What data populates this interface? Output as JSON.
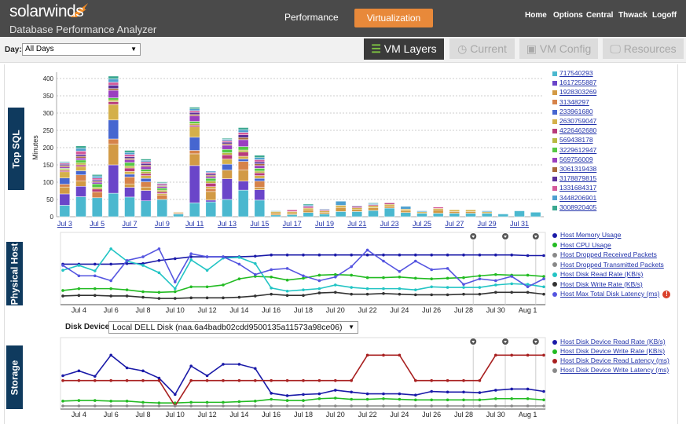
{
  "header": {
    "brand": "solarwinds",
    "product": "Database Performance Analyzer",
    "nav_main": [
      {
        "label": "Performance",
        "active": false
      },
      {
        "label": "Virtualization",
        "active": true
      }
    ],
    "nav_links": [
      "Home",
      "Options",
      "Central",
      "Thwack",
      "Logoff"
    ],
    "accent_color": "#e8893a"
  },
  "toolbar": {
    "day_label": "Day:",
    "day_value": "All Days",
    "tabs": [
      {
        "label": "VM Layers",
        "icon": "layers-icon",
        "active": true
      },
      {
        "label": "Current",
        "icon": "clock-icon",
        "active": false
      },
      {
        "label": "VM Config",
        "icon": "vm-icon",
        "active": false
      },
      {
        "label": "Resources",
        "icon": "monitor-icon",
        "active": false
      }
    ]
  },
  "sections": {
    "top_sql": "Top SQL",
    "physical_host": "Physical Host",
    "storage": "Storage"
  },
  "storage_controls": {
    "disk_label": "Disk Device:",
    "disk_value": "Local DELL Disk (naa.6a4badb02cdd9500135a11573a98ce06)"
  },
  "chart_data": [
    {
      "type": "bar",
      "stacked": true,
      "ylabel": "Minutes",
      "ylim": [
        0,
        400
      ],
      "yticks": [
        0,
        50,
        100,
        150,
        200,
        250,
        300,
        350,
        400
      ],
      "grid": true,
      "legend": "right",
      "categories": [
        "Jul 3",
        "Jul 4",
        "Jul 5",
        "Jul 6",
        "Jul 7",
        "Jul 8",
        "Jul 9",
        "Jul 10",
        "Jul 11",
        "Jul 12",
        "Jul 13",
        "Jul 14",
        "Jul 15",
        "Jul 16",
        "Jul 17",
        "Jul 18",
        "Jul 19",
        "Jul 20",
        "Jul 21",
        "Jul 22",
        "Jul 23",
        "Jul 24",
        "Jul 25",
        "Jul 26",
        "Jul 27",
        "Jul 28",
        "Jul 29",
        "Jul 30",
        "Jul 31",
        "Aug 1"
      ],
      "xtick_labels": [
        "Jul 3",
        "Jul 5",
        "Jul 7",
        "Jul 9",
        "Jul 11",
        "Jul 13",
        "Jul 15",
        "Jul 17",
        "Jul 19",
        "Jul 21",
        "Jul 23",
        "Jul 25",
        "Jul 27",
        "Jul 29",
        "Jul 31"
      ],
      "series": [
        {
          "name": "717540293",
          "color": "#4bb8cf",
          "values": [
            33,
            58,
            55,
            68,
            57,
            46,
            50,
            8,
            40,
            43,
            50,
            77,
            48,
            5,
            6,
            12,
            8,
            15,
            15,
            18,
            25,
            12,
            10,
            10,
            10,
            10,
            10,
            8,
            17,
            13
          ]
        },
        {
          "name": "1617255887",
          "color": "#6a45c9",
          "values": [
            33,
            30,
            0,
            82,
            28,
            30,
            0,
            0,
            108,
            5,
            60,
            26,
            30,
            0,
            0,
            0,
            0,
            0,
            0,
            0,
            0,
            0,
            0,
            0,
            0,
            0,
            0,
            0,
            0,
            0
          ]
        },
        {
          "name": "1928303269",
          "color": "#d29a45",
          "values": [
            20,
            15,
            0,
            60,
            10,
            10,
            0,
            0,
            34,
            25,
            25,
            32,
            7,
            6,
            5,
            8,
            5,
            12,
            6,
            8,
            6,
            6,
            0,
            10,
            5,
            5,
            0,
            0,
            0,
            0
          ]
        },
        {
          "name": "31348297",
          "color": "#d6834a",
          "values": [
            8,
            18,
            17,
            15,
            20,
            15,
            12,
            3,
            10,
            8,
            0,
            25,
            18,
            0,
            0,
            0,
            0,
            0,
            0,
            0,
            0,
            0,
            0,
            0,
            0,
            0,
            0,
            0,
            0,
            0
          ]
        },
        {
          "name": "233961680",
          "color": "#4666d0",
          "values": [
            18,
            12,
            0,
            55,
            8,
            10,
            0,
            0,
            38,
            0,
            17,
            7,
            8,
            0,
            0,
            0,
            0,
            0,
            0,
            0,
            0,
            0,
            0,
            0,
            0,
            0,
            0,
            0,
            0,
            0
          ]
        },
        {
          "name": "2630759047",
          "color": "#d4b04a",
          "values": [
            18,
            12,
            0,
            45,
            8,
            8,
            5,
            2,
            30,
            6,
            15,
            8,
            8,
            4,
            4,
            5,
            4,
            6,
            5,
            6,
            5,
            4,
            4,
            4,
            5,
            5,
            4,
            0,
            0,
            0
          ]
        },
        {
          "name": "4226462680",
          "color": "#b83b7a",
          "values": [
            4,
            5,
            8,
            8,
            10,
            6,
            5,
            0,
            5,
            10,
            12,
            12,
            8,
            0,
            0,
            0,
            3,
            0,
            4,
            3,
            4,
            0,
            0,
            0,
            0,
            0,
            0,
            0,
            0,
            0
          ]
        },
        {
          "name": "569438178",
          "color": "#b8b840",
          "values": [
            4,
            6,
            5,
            5,
            6,
            6,
            5,
            0,
            5,
            6,
            6,
            6,
            5,
            0,
            0,
            0,
            0,
            0,
            0,
            0,
            0,
            0,
            0,
            0,
            0,
            0,
            0,
            0,
            0,
            0
          ]
        },
        {
          "name": "3229612947",
          "color": "#55c845",
          "values": [
            2,
            8,
            10,
            6,
            10,
            6,
            6,
            0,
            6,
            8,
            10,
            10,
            8,
            0,
            0,
            0,
            0,
            0,
            0,
            0,
            0,
            0,
            0,
            0,
            0,
            0,
            0,
            0,
            0,
            0
          ]
        },
        {
          "name": "569756009",
          "color": "#9a3fc0",
          "values": [
            4,
            6,
            5,
            22,
            8,
            8,
            4,
            0,
            16,
            5,
            12,
            20,
            8,
            0,
            0,
            0,
            0,
            0,
            0,
            0,
            0,
            0,
            0,
            0,
            0,
            0,
            0,
            0,
            0,
            0
          ]
        },
        {
          "name": "3061319438",
          "color": "#a86a3a",
          "values": [
            4,
            5,
            3,
            5,
            4,
            4,
            3,
            0,
            4,
            4,
            4,
            6,
            5,
            0,
            0,
            0,
            0,
            0,
            0,
            0,
            0,
            0,
            0,
            0,
            0,
            0,
            0,
            0,
            0,
            0
          ]
        },
        {
          "name": "3178879815",
          "color": "#5b2f9a",
          "values": [
            4,
            5,
            4,
            10,
            5,
            5,
            3,
            0,
            6,
            4,
            5,
            8,
            6,
            0,
            0,
            0,
            0,
            0,
            0,
            0,
            0,
            0,
            0,
            0,
            0,
            0,
            0,
            0,
            0,
            0
          ]
        },
        {
          "name": "1331684317",
          "color": "#d45a9a",
          "values": [
            3,
            10,
            5,
            8,
            6,
            5,
            3,
            1,
            5,
            4,
            4,
            7,
            6,
            0,
            5,
            5,
            0,
            0,
            0,
            0,
            0,
            0,
            0,
            4,
            0,
            0,
            0,
            0,
            0,
            0
          ]
        },
        {
          "name": "3448206901",
          "color": "#4fa0d0",
          "values": [
            3,
            8,
            6,
            10,
            6,
            4,
            2,
            0,
            5,
            4,
            4,
            8,
            6,
            2,
            0,
            4,
            2,
            12,
            2,
            3,
            0,
            8,
            3,
            0,
            0,
            0,
            3,
            0,
            0,
            0
          ]
        },
        {
          "name": "3008920405",
          "color": "#3aa890",
          "values": [
            2,
            7,
            4,
            8,
            6,
            4,
            3,
            0,
            5,
            0,
            3,
            6,
            7,
            0,
            0,
            3,
            0,
            0,
            0,
            2,
            0,
            0,
            0,
            0,
            0,
            0,
            0,
            0,
            0,
            0
          ]
        }
      ]
    },
    {
      "type": "line",
      "legend": "right",
      "x": [
        "Jul 3",
        "Jul 4",
        "Jul 5",
        "Jul 6",
        "Jul 7",
        "Jul 8",
        "Jul 9",
        "Jul 10",
        "Jul 11",
        "Jul 12",
        "Jul 13",
        "Jul 14",
        "Jul 15",
        "Jul 16",
        "Jul 17",
        "Jul 18",
        "Jul 19",
        "Jul 20",
        "Jul 21",
        "Jul 22",
        "Jul 23",
        "Jul 24",
        "Jul 25",
        "Jul 26",
        "Jul 27",
        "Jul 28",
        "Jul 29",
        "Jul 30",
        "Jul 31",
        "Aug 1",
        "Aug 2"
      ],
      "xtick_labels": [
        "Jul 4",
        "Jul 6",
        "Jul 8",
        "Jul 10",
        "Jul 12",
        "Jul 14",
        "Jul 16",
        "Jul 18",
        "Jul 20",
        "Jul 22",
        "Jul 24",
        "Jul 26",
        "Jul 28",
        "Jul 30",
        "Aug 1"
      ],
      "ylim": [
        0,
        100
      ],
      "series": [
        {
          "name": "Host Memory Usage",
          "color": "#1a1aa8",
          "values": [
            61,
            61,
            61,
            61,
            62,
            62,
            67,
            70,
            73,
            73,
            73,
            73,
            74,
            76,
            76,
            76,
            76,
            76,
            76,
            76,
            76,
            76,
            76,
            76,
            76,
            76,
            76,
            76,
            76,
            75,
            75
          ]
        },
        {
          "name": "Host CPU Usage",
          "color": "#22bb22",
          "values": [
            18,
            21,
            21,
            21,
            19,
            16,
            15,
            16,
            24,
            24,
            27,
            37,
            41,
            40,
            35,
            38,
            43,
            44,
            43,
            39,
            39,
            40,
            38,
            37,
            38,
            39,
            42,
            44,
            43,
            43,
            41
          ]
        },
        {
          "name": "Host Dropped Received Packets",
          "color": "#888888",
          "values": []
        },
        {
          "name": "Host Dropped Transmitted Packets",
          "color": "#888888",
          "values": []
        },
        {
          "name": "Host Disk Read Rate (KB/s)",
          "color": "#22c4c4",
          "values": [
            51,
            59,
            50,
            86,
            66,
            59,
            47,
            21,
            68,
            51,
            71,
            72,
            62,
            22,
            17,
            19,
            21,
            27,
            23,
            21,
            21,
            21,
            19,
            24,
            23,
            23,
            23,
            27,
            29,
            28,
            24
          ]
        },
        {
          "name": "Host Disk Write Rate (KB/s)",
          "color": "#333333",
          "values": [
            9,
            10,
            10,
            9,
            9,
            7,
            5,
            5,
            6,
            6,
            6,
            7,
            9,
            12,
            10,
            10,
            14,
            15,
            12,
            12,
            13,
            12,
            11,
            11,
            11,
            12,
            12,
            15,
            15,
            15,
            12
          ]
        },
        {
          "name": "Host Max Total Disk Latency (ms)",
          "color": "#5555e0",
          "values": [
            59,
            42,
            42,
            34,
            67,
            73,
            86,
            32,
            78,
            73,
            73,
            61,
            44,
            52,
            54,
            42,
            34,
            40,
            57,
            84,
            66,
            49,
            66,
            52,
            54,
            28,
            37,
            34,
            41,
            24,
            37
          ],
          "alert": true
        }
      ]
    },
    {
      "type": "line",
      "legend": "right",
      "x": [
        "Jul 3",
        "Jul 4",
        "Jul 5",
        "Jul 6",
        "Jul 7",
        "Jul 8",
        "Jul 9",
        "Jul 10",
        "Jul 11",
        "Jul 12",
        "Jul 13",
        "Jul 14",
        "Jul 15",
        "Jul 16",
        "Jul 17",
        "Jul 18",
        "Jul 19",
        "Jul 20",
        "Jul 21",
        "Jul 22",
        "Jul 23",
        "Jul 24",
        "Jul 25",
        "Jul 26",
        "Jul 27",
        "Jul 28",
        "Jul 29",
        "Jul 30",
        "Jul 31",
        "Aug 1",
        "Aug 2"
      ],
      "xtick_labels": [
        "Jul 4",
        "Jul 6",
        "Jul 8",
        "Jul 10",
        "Jul 12",
        "Jul 14",
        "Jul 16",
        "Jul 18",
        "Jul 20",
        "Jul 22",
        "Jul 24",
        "Jul 26",
        "Jul 28",
        "Jul 30",
        "Aug 1"
      ],
      "ylim": [
        0,
        100
      ],
      "series": [
        {
          "name": "Host Disk Device Read Rate (KB/s)",
          "color": "#1a1aa8",
          "values": [
            50,
            58,
            49,
            84,
            63,
            58,
            46,
            19,
            66,
            50,
            69,
            69,
            62,
            21,
            17,
            19,
            20,
            26,
            23,
            20,
            20,
            20,
            18,
            24,
            23,
            23,
            22,
            26,
            28,
            28,
            24
          ]
        },
        {
          "name": "Host Disk Device Write Rate (KB/s)",
          "color": "#22bb22",
          "values": [
            8,
            9,
            9,
            8,
            8,
            6,
            5,
            5,
            6,
            6,
            6,
            7,
            8,
            11,
            9,
            9,
            12,
            13,
            11,
            11,
            12,
            11,
            10,
            10,
            10,
            10,
            10,
            12,
            12,
            12,
            10
          ]
        },
        {
          "name": "Host Disk Device Read Latency (ms)",
          "color": "#a82020",
          "values": [
            42,
            42,
            42,
            42,
            42,
            42,
            42,
            0,
            42,
            42,
            42,
            42,
            42,
            42,
            42,
            42,
            42,
            42,
            42,
            84,
            84,
            84,
            42,
            42,
            42,
            42,
            42,
            84,
            84,
            84,
            84
          ]
        },
        {
          "name": "Host Disk Device Write Latency (ms)",
          "color": "#888888",
          "values": [
            0,
            0,
            0,
            0,
            0,
            0,
            0,
            0,
            0,
            0,
            0,
            0,
            0,
            0,
            0,
            0,
            0,
            0,
            0,
            0,
            0,
            0,
            0,
            0,
            0,
            0,
            0,
            0,
            0,
            0,
            0
          ]
        }
      ]
    }
  ]
}
